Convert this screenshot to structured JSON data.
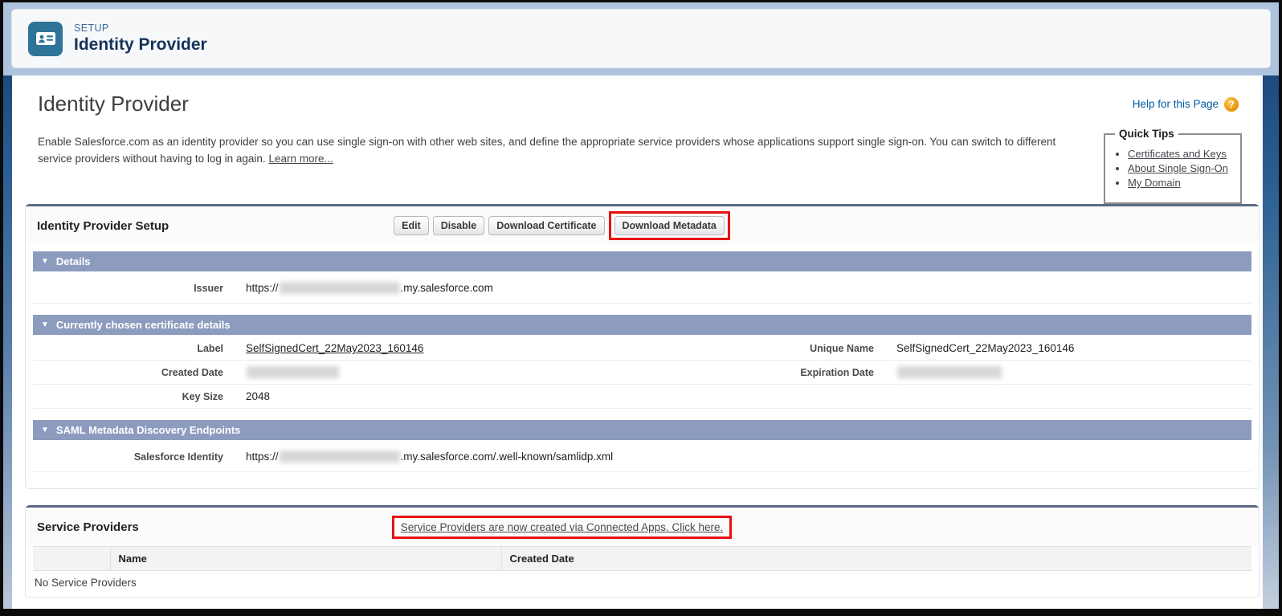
{
  "colors": {
    "annotation_red": "#e81010",
    "subsection_header_blue": "#8d9cbe",
    "setup_icon_blue": "#2e7499",
    "banner_background_blue": "#adc3de",
    "help_link_blue": "#015ba7"
  },
  "setup_header": {
    "eyebrow": "SETUP",
    "title": "Identity Provider"
  },
  "page": {
    "title": "Identity Provider",
    "help_link": "Help for this Page",
    "help_icon": "?",
    "description": "Enable Salesforce.com as an identity provider so you can use single sign-on with other web sites, and define the appropriate service providers whose applications support single sign-on. You can switch to different service providers without having to log in again.",
    "learn_more": "Learn more..."
  },
  "quick_tips": {
    "title": "Quick Tips",
    "links": [
      "Certificates and Keys",
      "About Single Sign-On",
      "My Domain"
    ]
  },
  "setup_section": {
    "title": "Identity Provider Setup",
    "buttons": [
      {
        "label": "Edit",
        "highlighted": false
      },
      {
        "label": "Disable",
        "highlighted": false
      },
      {
        "label": "Download Certificate",
        "highlighted": false
      },
      {
        "label": "Download Metadata",
        "highlighted": true
      }
    ]
  },
  "details": {
    "title": "Details",
    "issuer_label": "Issuer",
    "issuer_prefix": "https://",
    "issuer_redacted": "[redacted]",
    "issuer_suffix": ".my.salesforce.com"
  },
  "certificate": {
    "title": "Currently chosen certificate details",
    "label_label": "Label",
    "label_value": "SelfSignedCert_22May2023_160146",
    "unique_name_label": "Unique Name",
    "unique_name_value": "SelfSignedCert_22May2023_160146",
    "created_date_label": "Created Date",
    "created_date_value_redacted": "[redacted]",
    "expiration_date_label": "Expiration Date",
    "expiration_date_value_redacted": "[redacted]",
    "key_size_label": "Key Size",
    "key_size_value": "2048"
  },
  "saml": {
    "title": "SAML Metadata Discovery Endpoints",
    "identity_label": "Salesforce Identity",
    "identity_prefix": "https://",
    "identity_redacted": "[redacted]",
    "identity_suffix": ".my.salesforce.com/.well-known/samlidp.xml"
  },
  "service_providers": {
    "title": "Service Providers",
    "banner_link": "Service Providers are now created via Connected Apps. Click here.",
    "table": {
      "headers": [
        "",
        "Name",
        "Created Date"
      ],
      "empty_message": "No Service Providers"
    }
  }
}
